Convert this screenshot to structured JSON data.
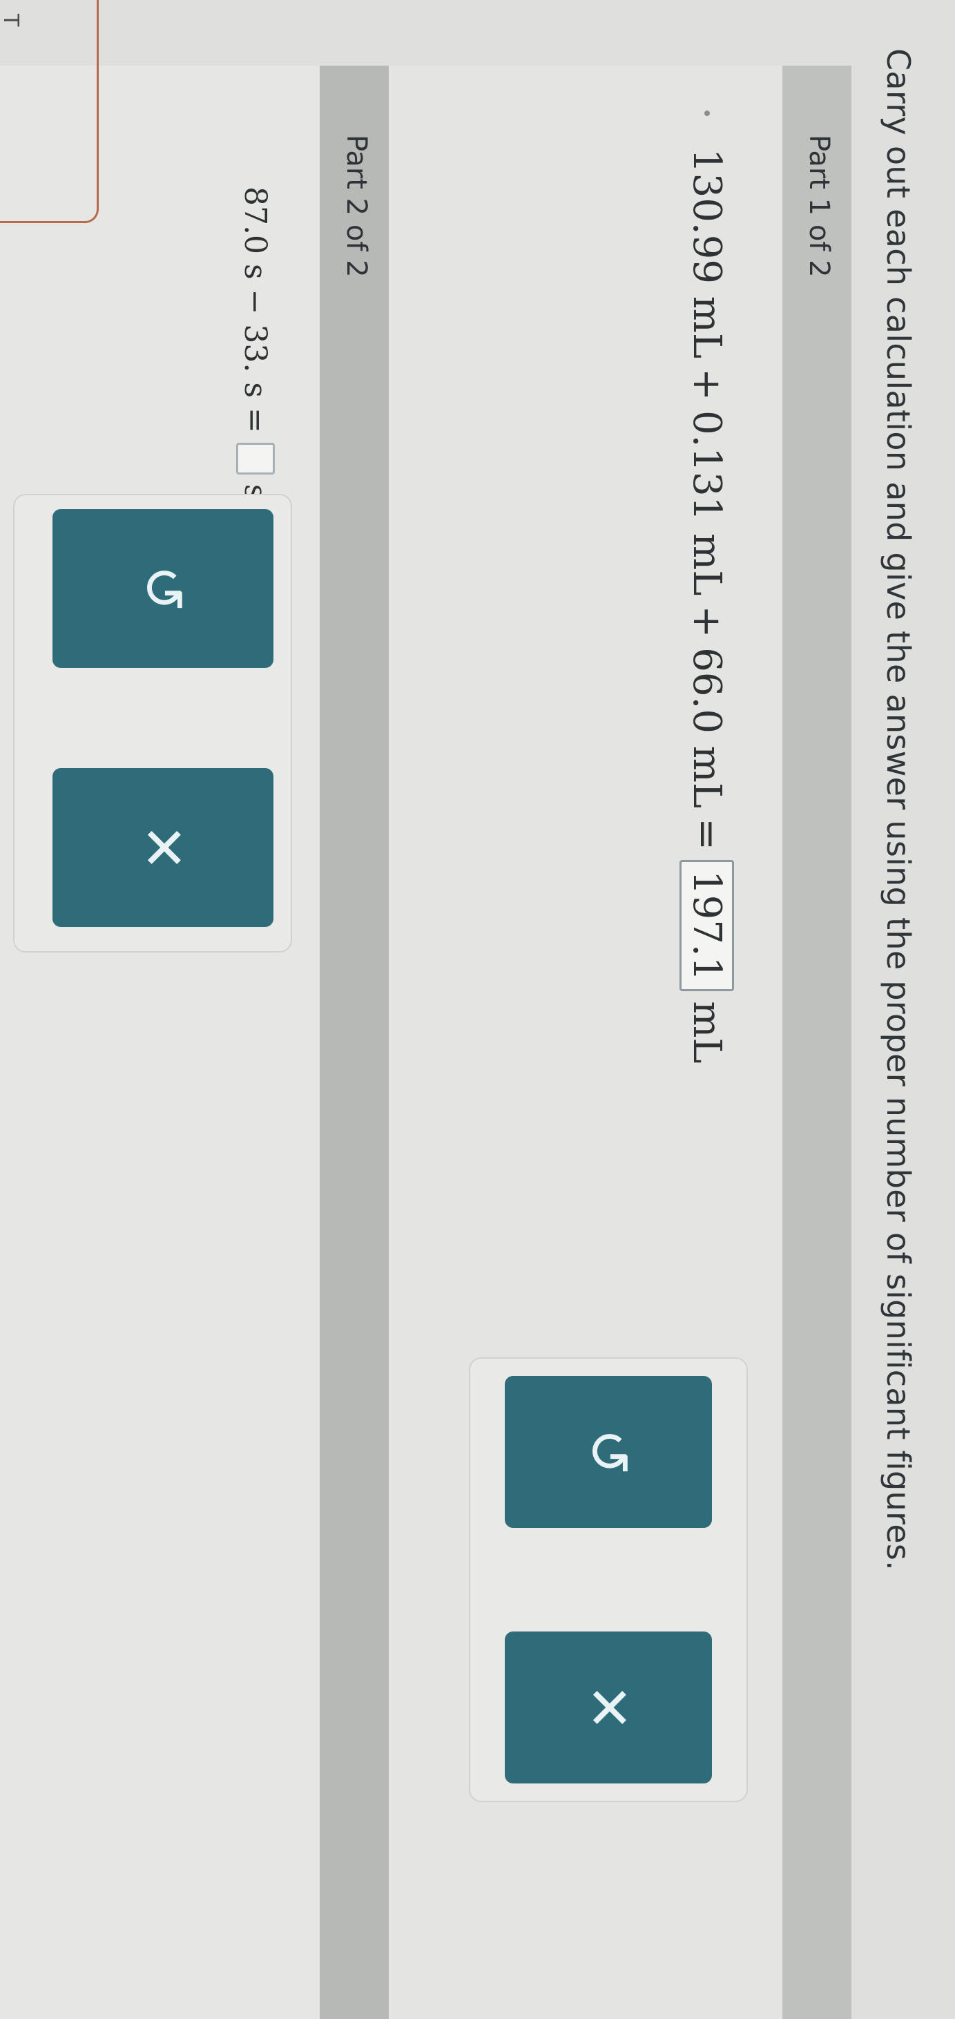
{
  "instructions": "Carry out each calculation and give the answer using the proper number of significant figures.",
  "part1": {
    "label": "Part 1 of 2",
    "equation": {
      "term1": "130.99 mL",
      "op1": "+",
      "term2": "0.131 mL",
      "op2": "+",
      "term3": "66.0 mL",
      "equals": "=",
      "answer": "197.1",
      "unit": "mL"
    },
    "buttons": {
      "undo_icon": "↺",
      "clear_icon": "✕"
    }
  },
  "part2": {
    "label": "Part 2 of 2",
    "equation": {
      "term1": "87.0 s",
      "op1": "−",
      "term2": "33. s",
      "equals": "=",
      "answer": "",
      "unit": "s"
    },
    "buttons": {
      "undo_icon": "↺",
      "clear_icon": "✕"
    }
  },
  "side_label": "T"
}
